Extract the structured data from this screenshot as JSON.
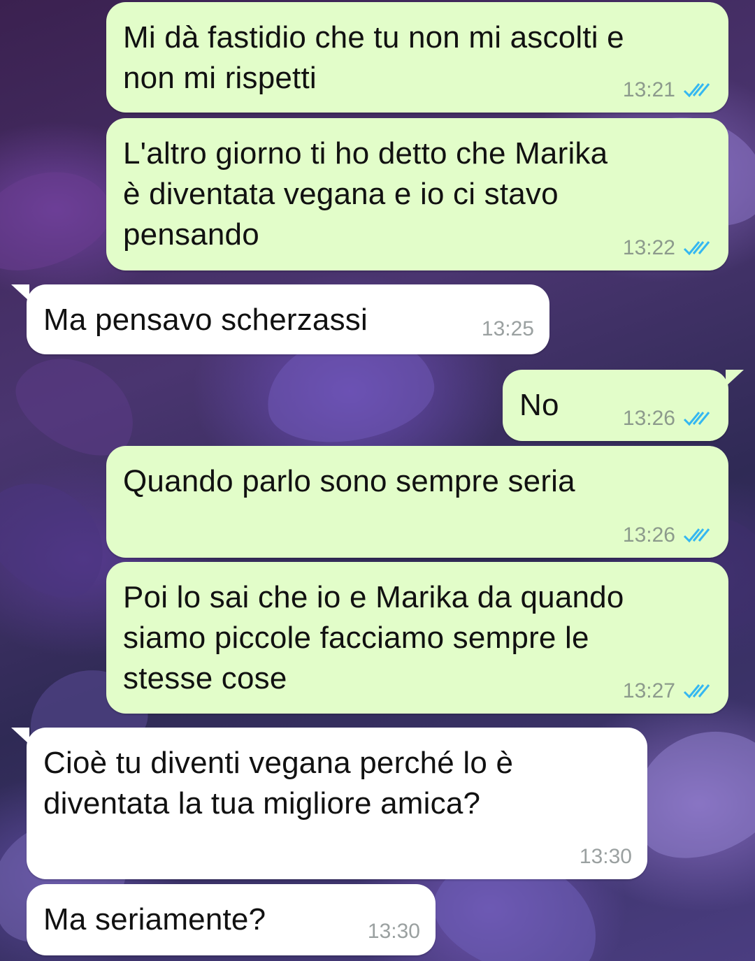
{
  "messages": [
    {
      "direction": "outgoing",
      "text": "Mi dà fastidio che tu non mi ascolti e\nnon mi rispetti",
      "time": "13:21",
      "status": "read"
    },
    {
      "direction": "outgoing",
      "text": "L'altro giorno ti ho detto che Marika\nè diventata vegana e io ci stavo\npensando",
      "time": "13:22",
      "status": "read"
    },
    {
      "direction": "incoming",
      "text": "Ma pensavo scherzassi",
      "time": "13:25"
    },
    {
      "direction": "outgoing",
      "text": "No",
      "time": "13:26",
      "status": "read"
    },
    {
      "direction": "outgoing",
      "text": "Quando parlo sono sempre seria",
      "time": "13:26",
      "status": "read"
    },
    {
      "direction": "outgoing",
      "text": "Poi lo sai che io e Marika da quando\nsiamo piccole facciamo sempre le\nstesse cose",
      "time": "13:27",
      "status": "read"
    },
    {
      "direction": "incoming",
      "text": "Cioè tu diventi vegana perché lo è\ndiventata la tua migliore amica?",
      "time": "13:30"
    },
    {
      "direction": "incoming",
      "text": "Ma seriamente?",
      "time": "13:30"
    }
  ],
  "colors": {
    "outgoing_bubble": "#e2fdc9",
    "incoming_bubble": "#ffffff",
    "read_ticks": "#34b7f1"
  },
  "icons": {
    "read_receipt": "double-check-icon",
    "wallpaper": "lilac-flowers-wallpaper"
  }
}
